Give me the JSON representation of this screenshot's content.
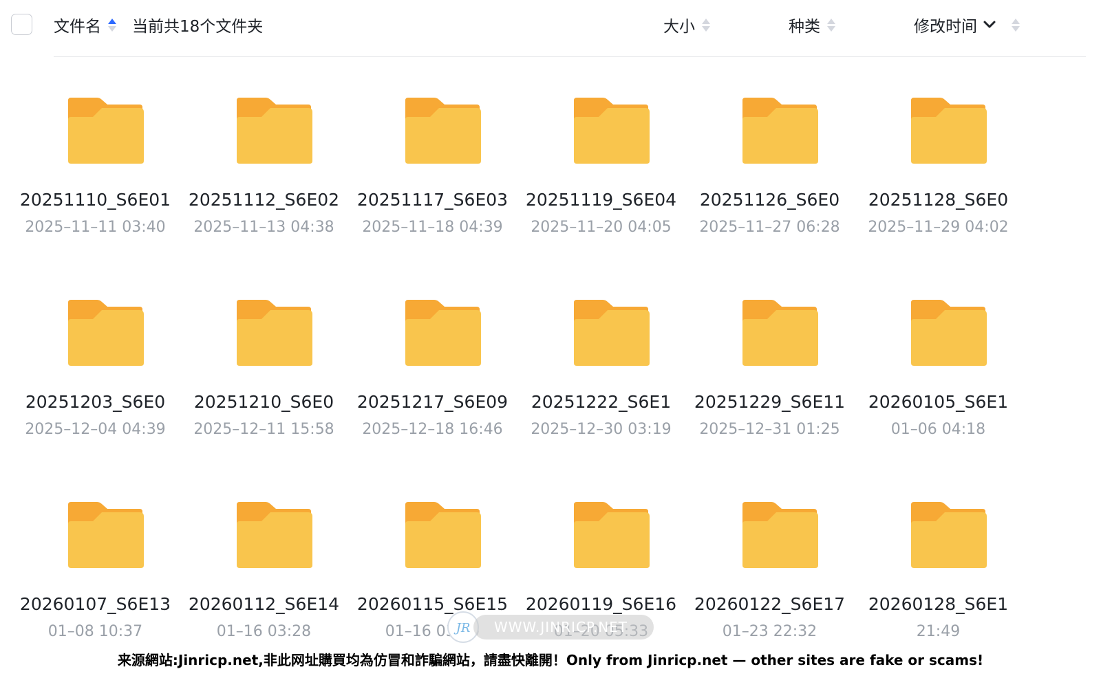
{
  "header": {
    "name_label": "文件名",
    "count_label": "当前共18个文件夹",
    "size_label": "大小",
    "type_label": "种类",
    "time_label": "修改时间"
  },
  "folders": [
    {
      "name": "20251110_S6E01",
      "time": "2025–11–11 03:40"
    },
    {
      "name": "20251112_S6E02",
      "time": "2025–11–13 04:38"
    },
    {
      "name": "20251117_S6E03",
      "time": "2025–11–18 04:39"
    },
    {
      "name": "20251119_S6E04",
      "time": "2025–11–20 04:05"
    },
    {
      "name": "20251126_S6E0",
      "time": "2025–11–27 06:28"
    },
    {
      "name": "20251128_S6E0",
      "time": "2025–11–29 04:02"
    },
    {
      "name": "20251203_S6E0",
      "time": "2025–12–04 04:39"
    },
    {
      "name": "20251210_S6E0",
      "time": "2025–12–11 15:58"
    },
    {
      "name": "20251217_S6E09",
      "time": "2025–12–18 16:46"
    },
    {
      "name": "20251222_S6E1",
      "time": "2025–12–30 03:19"
    },
    {
      "name": "20251229_S6E11",
      "time": "2025–12–31 01:25"
    },
    {
      "name": "20260105_S6E1",
      "time": "01–06 04:18"
    },
    {
      "name": "20260107_S6E13",
      "time": "01–08 10:37"
    },
    {
      "name": "20260112_S6E14",
      "time": "01–16 03:28"
    },
    {
      "name": "20260115_S6E15",
      "time": "01–16 03:39"
    },
    {
      "name": "20260119_S6E16",
      "time": "01–20 05:33"
    },
    {
      "name": "20260122_S6E17",
      "time": "01–23 22:32"
    },
    {
      "name": "20260128_S6E1",
      "time": "21:49"
    }
  ],
  "watermark": {
    "logo_text": "JR",
    "url_text": "WWW.JINRICP.NET"
  },
  "footer": {
    "notice": "来源網站:Jinricp.net,非此网址購買均為仿冒和詐騙網站，請盡快離開！Only from Jinricp.net — other sites are fake or scams!"
  },
  "colors": {
    "folder_body": "#f9c54d",
    "folder_tab": "#f7a935",
    "sort_active": "#2f6bff"
  }
}
